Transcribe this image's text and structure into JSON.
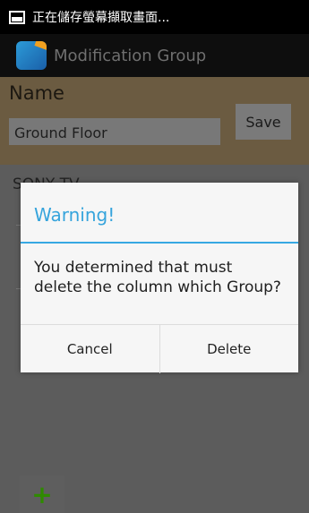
{
  "statusbar": {
    "text": "正在儲存螢幕擷取畫面..."
  },
  "actionbar": {
    "title": "Modification Group"
  },
  "form": {
    "name_label": "Name",
    "name_value": "Ground Floor",
    "save_label": "Save"
  },
  "list": {
    "first_item": "SONY TV"
  },
  "dialog": {
    "title": "Warning!",
    "message": "You determined that must delete the column which Group?",
    "cancel_label": "Cancel",
    "delete_label": "Delete"
  },
  "fab": {
    "add_label": "+"
  },
  "colors": {
    "accent": "#36a4dc",
    "add_green": "#2f8a00"
  }
}
